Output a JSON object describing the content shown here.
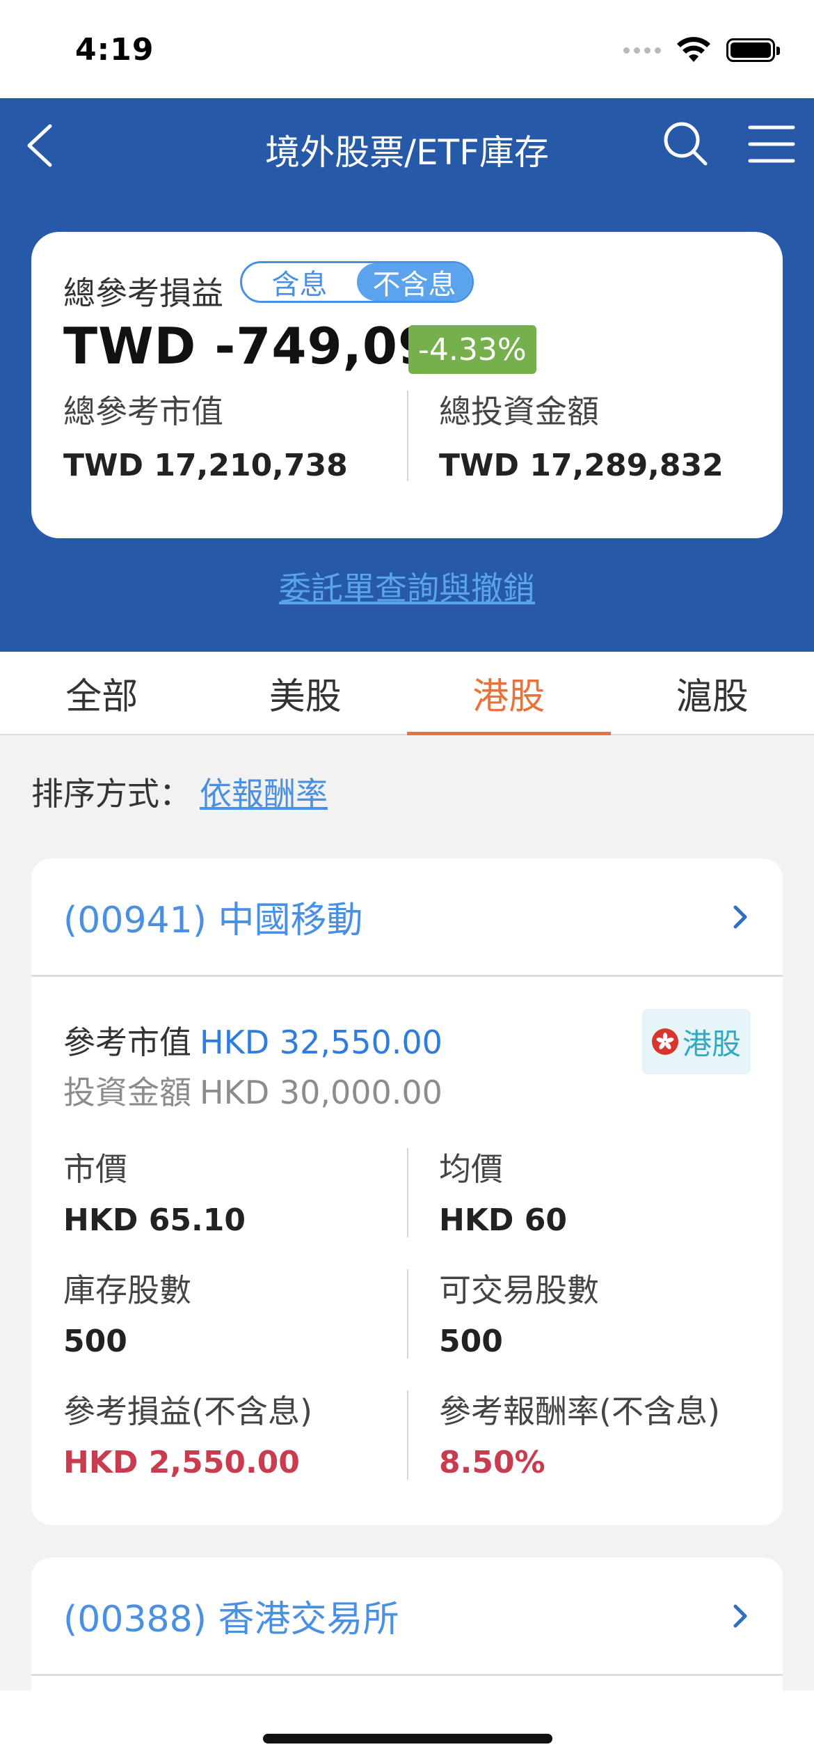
{
  "status": {
    "time": "4:19"
  },
  "nav": {
    "title": "境外股票/ETF庫存"
  },
  "summary": {
    "label": "總參考損益",
    "toggle": [
      "含息",
      "不含息"
    ],
    "toggle_selected": "不含息",
    "amount": "TWD -749,094",
    "pct": "-4.33%",
    "market_value_label": "總參考市值",
    "market_value": "TWD 17,210,738",
    "invest_label": "總投資金額",
    "invest_value": "TWD 17,289,832"
  },
  "order_link": "委託單查詢與撤銷",
  "tabs": [
    "全部",
    "美股",
    "港股",
    "滬股"
  ],
  "active_tab": "港股",
  "sort": {
    "label": "排序方式：",
    "value": "依報酬率"
  },
  "holdings": [
    {
      "name": "(00941) 中國移動",
      "mv_label": "參考市值",
      "mv_value": "HKD 32,550.00",
      "inv_label": "投資金額",
      "inv_value": "HKD 30,000.00",
      "market": "港股",
      "price_label": "市價",
      "price": "HKD 65.10",
      "avg_label": "均價",
      "avg": "HKD 60",
      "shares_label": "庫存股數",
      "shares": "500",
      "tradable_label": "可交易股數",
      "tradable": "500",
      "pl_label": "參考損益(不含息)",
      "pl": "HKD 2,550.00",
      "ret_label": "參考報酬率(不含息)",
      "ret": "8.50%"
    },
    {
      "name": "(00388) 香港交易所"
    }
  ],
  "colors": {
    "header_blue": "#2659a8",
    "link_blue": "#4a90e2",
    "active_tab": "#e8733a",
    "gain_red": "#c93c50",
    "pct_badge_green": "#75b04c",
    "market_badge_bg": "#e6f5f7"
  }
}
